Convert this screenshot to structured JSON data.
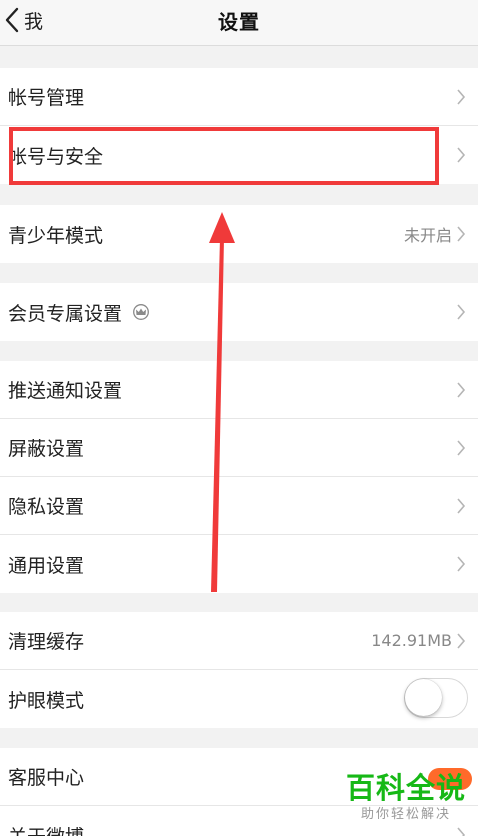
{
  "nav": {
    "back_label": "我",
    "title": "设置"
  },
  "groups": [
    [
      {
        "label": "帐号管理"
      },
      {
        "label": "帐号与安全"
      }
    ],
    [
      {
        "label": "青少年模式",
        "value": "未开启"
      }
    ],
    [
      {
        "label": "会员专属设置",
        "icon": "crown-icon"
      }
    ],
    [
      {
        "label": "推送通知设置"
      },
      {
        "label": "屏蔽设置"
      },
      {
        "label": "隐私设置"
      },
      {
        "label": "通用设置"
      }
    ],
    [
      {
        "label": "清理缓存",
        "value": "142.91MB"
      },
      {
        "label": "护眼模式",
        "toggle": false
      }
    ],
    [
      {
        "label": "客服中心"
      },
      {
        "label": "关于微博"
      }
    ]
  ],
  "annotation": {
    "highlight_color": "#f03a3a",
    "arrow_color": "#f03a3a"
  },
  "watermark": {
    "main": "百科全说",
    "sub": "助你轻松解决",
    "color": "#16b816"
  }
}
